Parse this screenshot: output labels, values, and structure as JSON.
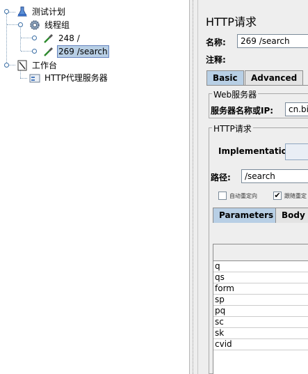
{
  "tree": {
    "nodes": [
      {
        "label": "测试计划",
        "icon": "test-plan-icon"
      },
      {
        "label": "线程组",
        "icon": "thread-group-gear-icon"
      },
      {
        "label": "248 /",
        "icon": "http-sampler-pipette-icon"
      },
      {
        "label": "269 /search",
        "icon": "http-sampler-pipette-icon",
        "selected": true
      },
      {
        "label": "工作台",
        "icon": "workbench-clipboard-icon"
      },
      {
        "label": "HTTP代理服务器",
        "icon": "proxy-server-icon"
      }
    ]
  },
  "panel": {
    "title": "HTTP请求",
    "name_label": "名称:",
    "name_value": "269 /search",
    "comment_label": "注释:",
    "tabs": [
      "Basic",
      "Advanced"
    ],
    "web_server": {
      "group_title": "Web服务器",
      "server_label": "服务器名称或IP:",
      "server_value": "cn.bin"
    },
    "http_request": {
      "group_title": "HTTP请求",
      "implementation_label": "Implementation:",
      "path_label": "路径:",
      "path_value": "/search",
      "checkbox_redirect": "自动重定向",
      "checkbox_follow": "跟随重定"
    },
    "param_tabs": [
      "Parameters",
      "Body D"
    ],
    "parameters": [
      "q",
      "qs",
      "form",
      "sp",
      "pq",
      "sc",
      "sk",
      "cvid"
    ]
  },
  "colors": {
    "selection": "#b8cfe5",
    "active_tab": "#b8cfe5"
  }
}
